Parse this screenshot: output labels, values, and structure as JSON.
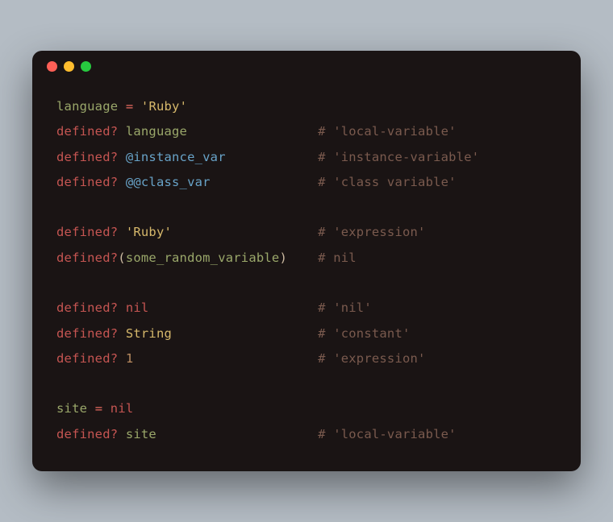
{
  "window": {
    "traffic_lights": [
      "close",
      "minimize",
      "zoom"
    ]
  },
  "code": {
    "col2_offset_ch": 34,
    "lines": [
      {
        "tokens": [
          [
            "var",
            "language"
          ],
          [
            "plain",
            " "
          ],
          [
            "op",
            "="
          ],
          [
            "plain",
            " "
          ],
          [
            "str",
            "'Ruby'"
          ]
        ]
      },
      {
        "tokens": [
          [
            "key",
            "defined?"
          ],
          [
            "plain",
            " "
          ],
          [
            "var",
            "language"
          ]
        ],
        "comment": "# 'local-variable'"
      },
      {
        "tokens": [
          [
            "key",
            "defined?"
          ],
          [
            "plain",
            " "
          ],
          [
            "ivar",
            "@instance_var"
          ]
        ],
        "comment": "# 'instance-variable'"
      },
      {
        "tokens": [
          [
            "key",
            "defined?"
          ],
          [
            "plain",
            " "
          ],
          [
            "ivar",
            "@@class_var"
          ]
        ],
        "comment": "# 'class variable'"
      },
      {
        "blank": true
      },
      {
        "tokens": [
          [
            "key",
            "defined?"
          ],
          [
            "plain",
            " "
          ],
          [
            "str",
            "'Ruby'"
          ]
        ],
        "comment": "# 'expression'"
      },
      {
        "tokens": [
          [
            "key",
            "defined?"
          ],
          [
            "plain",
            "("
          ],
          [
            "var",
            "some_random_variable"
          ],
          [
            "plain",
            ")"
          ]
        ],
        "comment": "# nil"
      },
      {
        "blank": true
      },
      {
        "tokens": [
          [
            "key",
            "defined?"
          ],
          [
            "plain",
            " "
          ],
          [
            "key",
            "nil"
          ]
        ],
        "comment": "# 'nil'"
      },
      {
        "tokens": [
          [
            "key",
            "defined?"
          ],
          [
            "plain",
            " "
          ],
          [
            "const",
            "String"
          ]
        ],
        "comment": "# 'constant'"
      },
      {
        "tokens": [
          [
            "key",
            "defined?"
          ],
          [
            "plain",
            " "
          ],
          [
            "num",
            "1"
          ]
        ],
        "comment": "# 'expression'"
      },
      {
        "blank": true
      },
      {
        "tokens": [
          [
            "var",
            "site"
          ],
          [
            "plain",
            " "
          ],
          [
            "op",
            "="
          ],
          [
            "plain",
            " "
          ],
          [
            "key",
            "nil"
          ]
        ]
      },
      {
        "tokens": [
          [
            "key",
            "defined?"
          ],
          [
            "plain",
            " "
          ],
          [
            "var",
            "site"
          ]
        ],
        "comment": "# 'local-variable'"
      }
    ]
  }
}
